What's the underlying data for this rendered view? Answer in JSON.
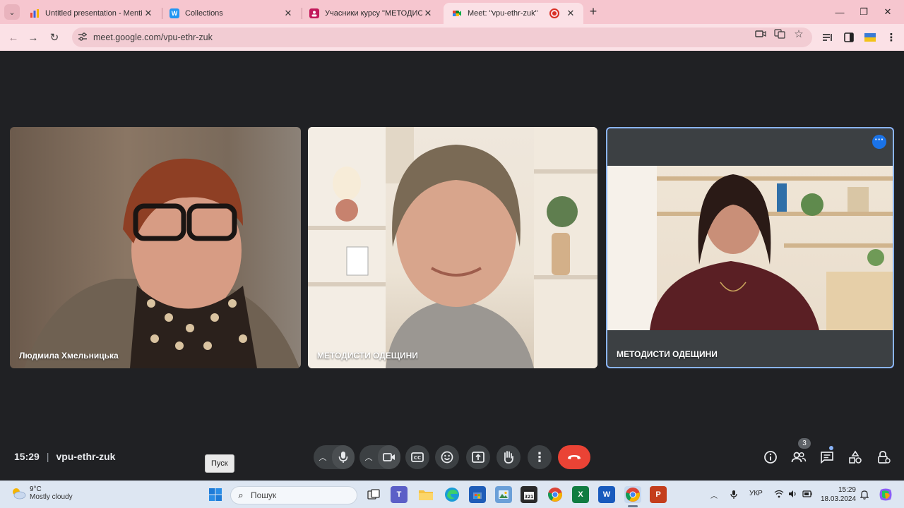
{
  "browser": {
    "tabs": [
      {
        "title": "Untitled presentation - Mentimeter",
        "favicon": "M",
        "color": "#3d63dd"
      },
      {
        "title": "Collections",
        "favicon": "W",
        "color": "#2196f3"
      },
      {
        "title": "Учасники курсу \"МЕТОДИСТИ",
        "favicon": "",
        "color": "#c2185b"
      },
      {
        "title": "Meet: \"vpu-ethr-zuk\"",
        "favicon": "",
        "color": "#00832d"
      }
    ],
    "close_glyph": "✕",
    "new_tab_glyph": "+",
    "url": "meet.google.com/vpu-ethr-zuk"
  },
  "meet": {
    "participants": [
      {
        "name": "Людмила Хмельницька"
      },
      {
        "name": "МЕТОДИСТИ ОДЕЩИНИ"
      },
      {
        "name": "МЕТОДИСТИ ОДЕЩИНИ"
      }
    ],
    "time": "15:29",
    "separator": "|",
    "meeting_code": "vpu-ethr-zuk",
    "people_count": "3",
    "tooltip": "Пуск"
  },
  "taskbar": {
    "weather_temp": "9°C",
    "weather_desc": "Mostly cloudy",
    "search_placeholder": "Пошук",
    "language": "УКР",
    "time": "15:29",
    "date": "18.03.2024"
  },
  "colors": {
    "meet_bg": "#202124",
    "control_bg": "#3c4043",
    "leave_red": "#ea4335",
    "active_border": "#8ab4f8",
    "chrome_pink": "#f6c6cf"
  }
}
